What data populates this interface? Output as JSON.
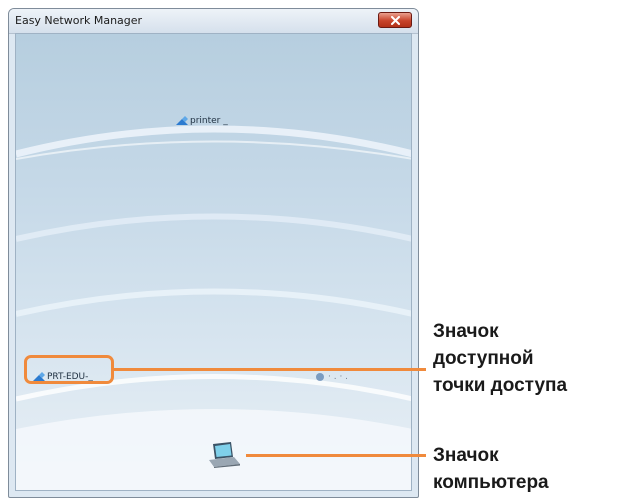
{
  "window": {
    "title": "Easy Network Manager"
  },
  "devices": {
    "printer": "printer _",
    "access_point": "PRT-EDU-_",
    "blurred": "· . · ."
  },
  "annotations": {
    "access_point": [
      "Значок",
      "доступной",
      "точки доступа"
    ],
    "computer": [
      "Значок",
      "компьютера"
    ]
  },
  "colors": {
    "callout": "#f08a3c",
    "close_button": "#c8442b"
  },
  "icons": {
    "close": "close-icon",
    "device": "device-icon",
    "computer": "laptop-icon"
  }
}
